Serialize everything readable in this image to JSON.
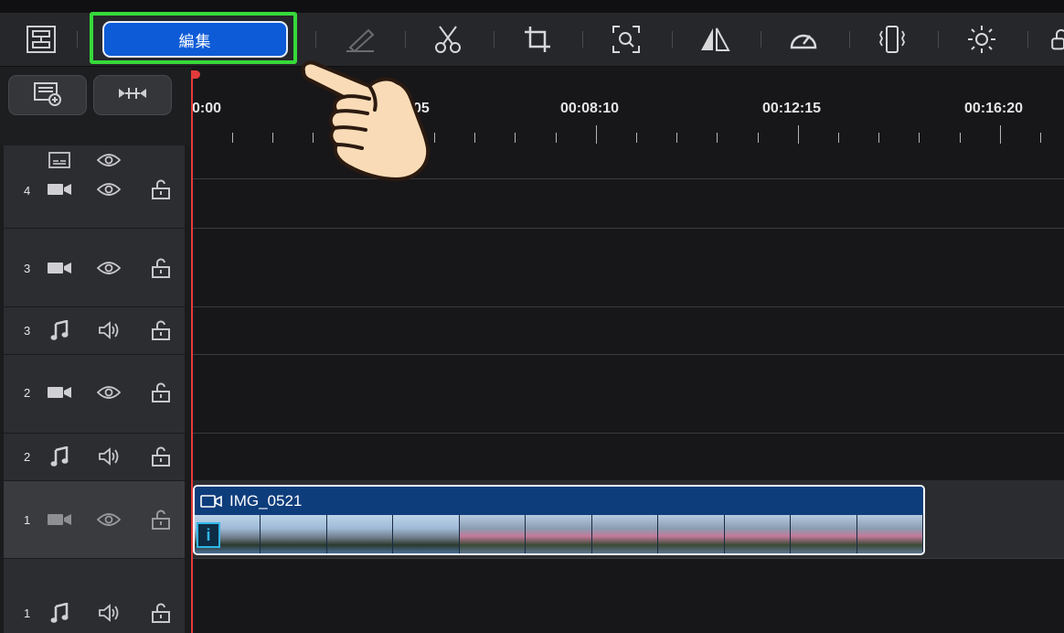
{
  "toolbar": {
    "edit_label": "編集",
    "icons": [
      "layout-icon",
      "edit-button",
      "pen-icon",
      "scissors-icon",
      "crop-icon",
      "zoom-icon",
      "flip-icon",
      "speed-icon",
      "stabilize-icon",
      "brightness-icon",
      "lock-icon"
    ]
  },
  "ruler": {
    "labels": [
      "0:00",
      "05",
      "00:08:10",
      "00:12:15",
      "00:16:20"
    ]
  },
  "tracks": [
    {
      "number": "4",
      "type": "video"
    },
    {
      "number": "3",
      "type": "video"
    },
    {
      "number": "3",
      "type": "audio"
    },
    {
      "number": "2",
      "type": "video"
    },
    {
      "number": "2",
      "type": "audio"
    },
    {
      "number": "1",
      "type": "video",
      "selected": true
    },
    {
      "number": "1",
      "type": "audio"
    }
  ],
  "clip": {
    "name": "IMG_0521",
    "badge": "i"
  },
  "colors": {
    "accent": "#0d5bd6",
    "highlight": "#36d93a",
    "playhead": "#e23b3b"
  }
}
